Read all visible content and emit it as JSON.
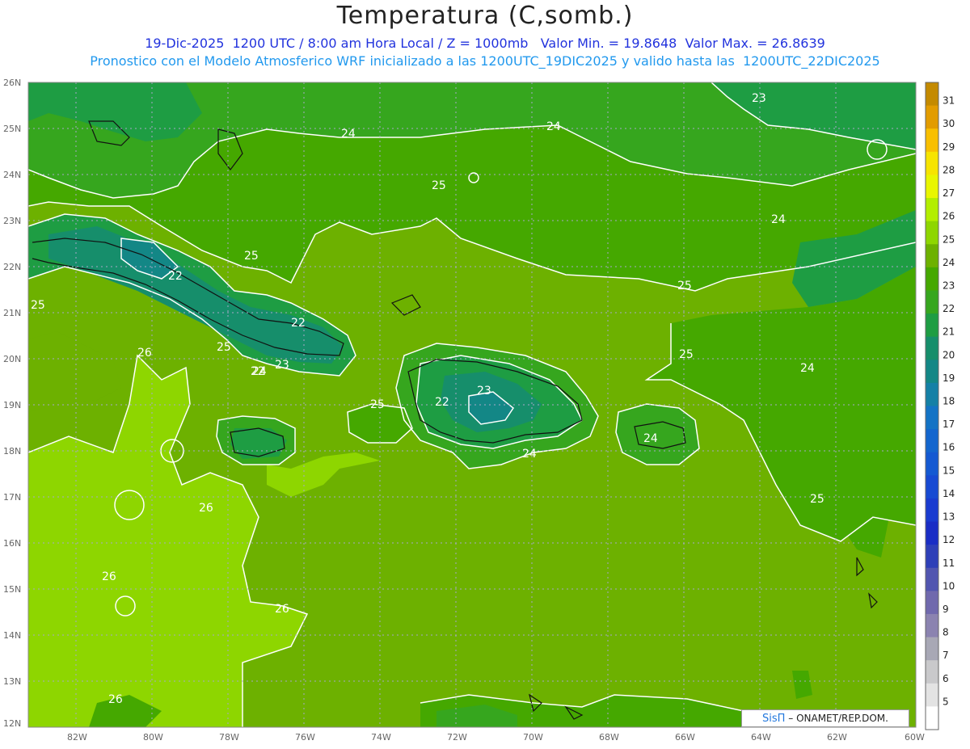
{
  "header": {
    "title": "Temperatura (C,somb.)",
    "subtitle_line1": "19-Dic-2025  1200 UTC / 8:00 am Hora Local / Z = 1000mb   Valor Min. = 19.8648  Valor Max. = 26.8639",
    "subtitle_line2": "Pronostico con el Modelo Atmosferico WRF inicializado a las 1200UTC_19DIC2025 y valido hasta las  1200UTC_22DIC2025"
  },
  "map": {
    "lat_labels": [
      "26N",
      "25N",
      "24N",
      "23N",
      "22N",
      "21N",
      "20N",
      "19N",
      "18N",
      "17N",
      "16N",
      "15N",
      "14N",
      "13N",
      "12N"
    ],
    "lon_labels": [
      "82W",
      "80W",
      "78W",
      "76W",
      "74W",
      "72W",
      "70W",
      "68W",
      "66W",
      "64W",
      "62W",
      "60W"
    ],
    "contour_labels": [
      "24",
      "24",
      "23",
      "24",
      "25",
      "25",
      "22",
      "22",
      "25",
      "25",
      "22",
      "25",
      "24",
      "23",
      "26",
      "25",
      "24",
      "22",
      "23",
      "25",
      "24",
      "24",
      "25",
      "26",
      "26",
      "26",
      "26"
    ]
  },
  "colorbar": {
    "levels": [
      "31",
      "30",
      "29",
      "28",
      "27",
      "26",
      "25",
      "24",
      "23",
      "22",
      "21",
      "20",
      "19",
      "18",
      "17",
      "16",
      "15",
      "14",
      "13",
      "12",
      "11",
      "10",
      "9",
      "8",
      "7",
      "6",
      "5"
    ],
    "colors": [
      "#c48a00",
      "#e29c00",
      "#f8bf00",
      "#f7e400",
      "#e9f600",
      "#b3ee00",
      "#8ed600",
      "#6db100",
      "#45a800",
      "#36a61e",
      "#1e9d43",
      "#168e6b",
      "#138786",
      "#1480a6",
      "#1373c5",
      "#1366ce",
      "#1459d2",
      "#174ad3",
      "#1a3bd0",
      "#1a2dc5",
      "#2e3fb8",
      "#5155b0",
      "#7069ad",
      "#8b83b0",
      "#a8a8b5",
      "#c9c9cb",
      "#e3e3e3",
      "#ffffff"
    ]
  },
  "credit": {
    "sis": "SisΠ",
    "org": " – ONAMET/REP.DOM."
  }
}
